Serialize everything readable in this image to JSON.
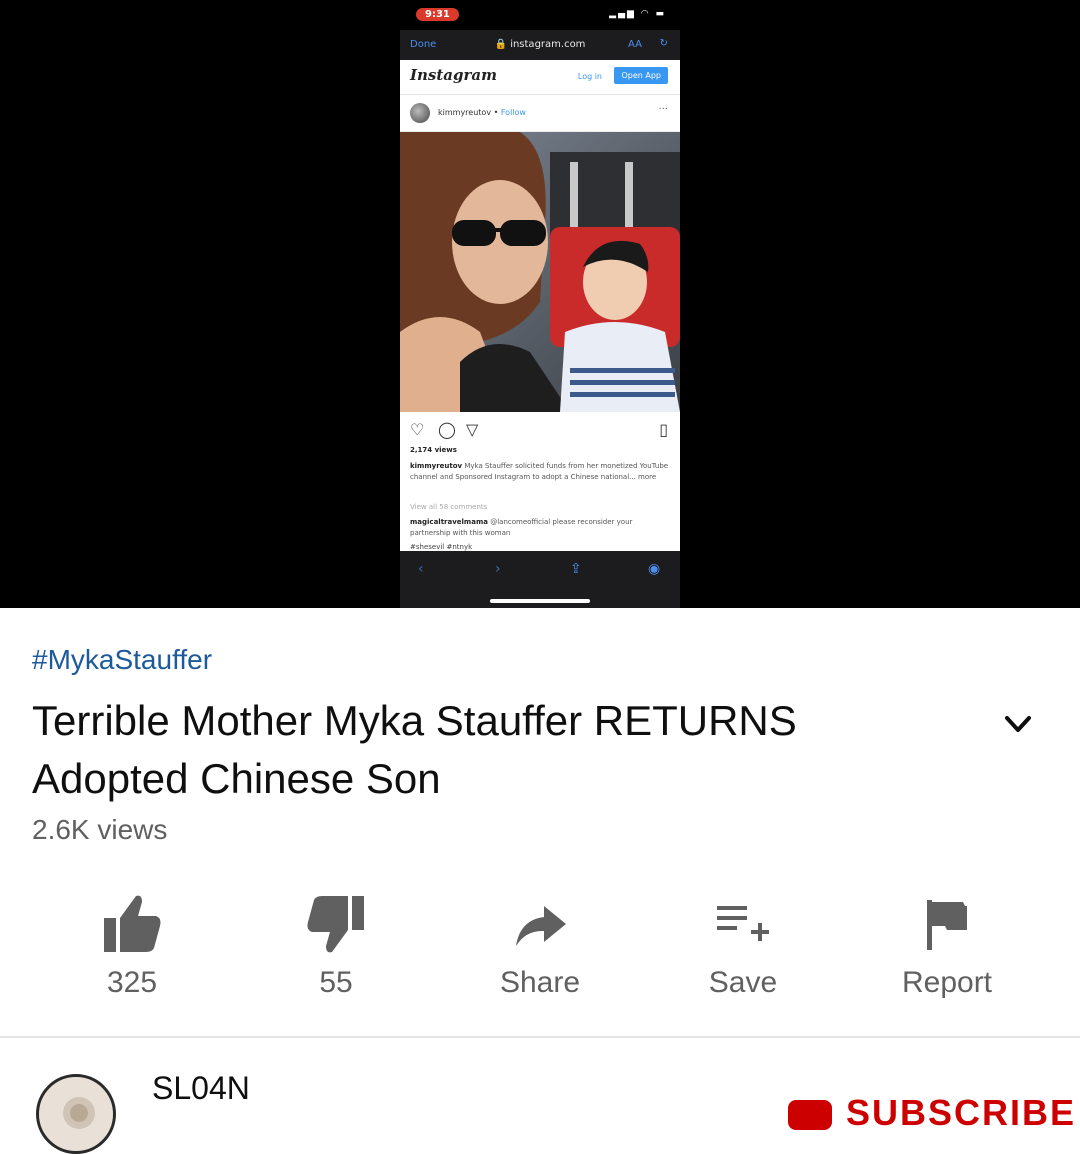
{
  "colors": {
    "hashtag": "#1c5a9c",
    "title": "#0f0f0f",
    "secondary_text": "#606060",
    "icon": "#606060",
    "subscribe_red": "#cc0000",
    "instagram_blue": "#3897f0"
  },
  "video": {
    "phone": {
      "time": "9:31",
      "safari": {
        "done_label": "Done",
        "url": "instagram.com",
        "aa_label": "AA"
      },
      "instagram": {
        "logo": "Instagram",
        "login_label": "Log in",
        "open_app_label": "Open App",
        "username": "kimmyreutov",
        "follow_label": "Follow",
        "views": "2,174 views",
        "caption_user": "kimmyreutov",
        "caption_text": "Myka Stauffer solicited funds from her monetized YouTube channel and Sponsored Instagram to adopt a Chinese national... more",
        "view_comments": "View all 58 comments",
        "comment_user": "magicaltravelmama",
        "comment_text": "@lancomeofficial please reconsider your partnership with this woman",
        "hashtags": "#shesevil #ntnyk"
      }
    }
  },
  "metadata": {
    "hashtag": "#MykaStauffer",
    "title": "Terrible Mother Myka Stauffer RETURNS Adopted Chinese Son",
    "views": "2.6K views",
    "expand_icon": "chevron-down-icon"
  },
  "actions": [
    {
      "icon": "thumbs-up-icon",
      "label": "325"
    },
    {
      "icon": "thumbs-down-icon",
      "label": "55"
    },
    {
      "icon": "share-icon",
      "label": "Share"
    },
    {
      "icon": "playlist-add-icon",
      "label": "Save"
    },
    {
      "icon": "flag-icon",
      "label": "Report"
    }
  ],
  "channel": {
    "name": "SL04N",
    "subscribe_label": "SUBSCRIBE"
  }
}
